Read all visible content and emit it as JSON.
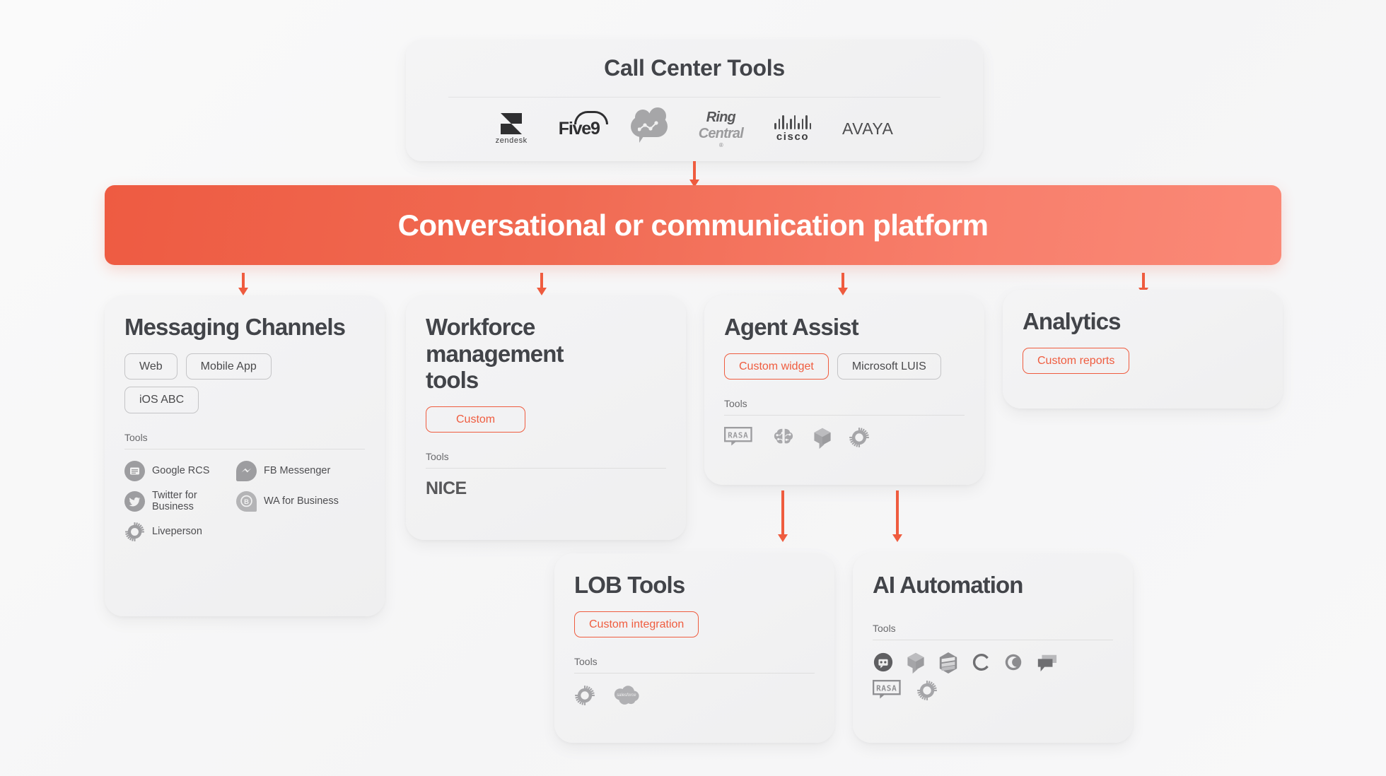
{
  "background_color": "#f8f8f8",
  "accent_color": "#ef5c3f",
  "banner": {
    "title": "Conversational or communication platform",
    "gradient_from": "#ee5b42",
    "gradient_to": "#fa8977",
    "text_color": "#ffffff"
  },
  "call_center": {
    "title": "Call Center Tools",
    "logos": [
      {
        "name": "zendesk",
        "label": "zendesk"
      },
      {
        "name": "five9",
        "label": "Five9"
      },
      {
        "name": "talkdesk",
        "label": "Talkdesk"
      },
      {
        "name": "ringcentral",
        "label_dark": "Ring",
        "label_light": "Central",
        "registered": "®"
      },
      {
        "name": "cisco",
        "label": "cisco"
      },
      {
        "name": "avaya",
        "label": "AVAYA"
      }
    ]
  },
  "cards": {
    "messaging": {
      "title": "Messaging Channels",
      "chips": [
        {
          "label": "Web",
          "accent": false
        },
        {
          "label": "Mobile App",
          "accent": false
        },
        {
          "label": "iOS ABC",
          "accent": false
        }
      ],
      "tools_label": "Tools",
      "tools": [
        {
          "label": "Google RCS",
          "icon": "google-rcs-icon"
        },
        {
          "label": "FB Messenger",
          "icon": "fb-messenger-icon"
        },
        {
          "label": "Twitter for Business",
          "icon": "twitter-icon"
        },
        {
          "label": "WA for Business",
          "icon": "whatsapp-business-icon"
        },
        {
          "label": "Liveperson",
          "icon": "liveperson-gear-icon"
        }
      ]
    },
    "workforce": {
      "title": "Workforce management tools",
      "chips": [
        {
          "label": "Custom",
          "accent": true
        }
      ],
      "tools_label": "Tools",
      "tools_text": "NICE"
    },
    "agent_assist": {
      "title": "Agent Assist",
      "chips": [
        {
          "label": "Custom widget",
          "accent": true
        },
        {
          "label": "Microsoft LUIS",
          "accent": false
        }
      ],
      "tools_label": "Tools",
      "tools": [
        {
          "icon": "rasa-icon",
          "label": "RASA"
        },
        {
          "icon": "ai-brain-icon",
          "label": "AI brain"
        },
        {
          "icon": "cube-chat-icon",
          "label": "Cube chat"
        },
        {
          "icon": "gear-icon",
          "label": "Gear"
        }
      ]
    },
    "analytics": {
      "title": "Analytics",
      "chips": [
        {
          "label": "Custom reports",
          "accent": true
        }
      ]
    },
    "lob": {
      "title": "LOB Tools",
      "chips": [
        {
          "label": "Custom integration",
          "accent": true
        }
      ],
      "tools_label": "Tools",
      "tools": [
        {
          "icon": "gear-icon",
          "label": "Gear"
        },
        {
          "icon": "salesforce-icon",
          "label": "salesforce"
        }
      ]
    },
    "ai_automation": {
      "title": "AI Automation",
      "tools_label": "Tools",
      "tools": [
        {
          "icon": "bot-circle-icon",
          "label": "Bot"
        },
        {
          "icon": "cube-chat-icon",
          "label": "Cube chat"
        },
        {
          "icon": "hex-stack-icon",
          "label": "Hex stack"
        },
        {
          "icon": "letter-c-icon",
          "label": "C"
        },
        {
          "icon": "moon-circle-icon",
          "label": "Moon"
        },
        {
          "icon": "chat-bubbles-icon",
          "label": "Chat bubbles"
        },
        {
          "icon": "rasa-icon",
          "label": "RASA"
        },
        {
          "icon": "gear-icon",
          "label": "Gear"
        }
      ]
    }
  },
  "arrows": [
    {
      "name": "arrow-callcenter-to-platform"
    },
    {
      "name": "arrow-platform-to-messaging"
    },
    {
      "name": "arrow-platform-to-workforce"
    },
    {
      "name": "arrow-platform-to-agentassist"
    },
    {
      "name": "arrow-platform-to-analytics"
    },
    {
      "name": "arrow-agentassist-to-lob"
    },
    {
      "name": "arrow-agentassist-to-aiautomation"
    }
  ]
}
